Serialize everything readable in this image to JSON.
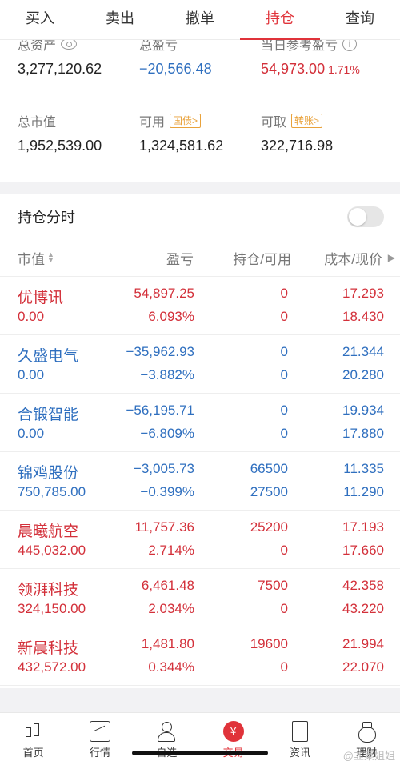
{
  "tabs": [
    {
      "label": "买入"
    },
    {
      "label": "卖出"
    },
    {
      "label": "撤单"
    },
    {
      "label": "持仓",
      "active": true
    },
    {
      "label": "查询"
    }
  ],
  "summary": {
    "total_assets_label": "总资产",
    "total_assets": "3,277,120.62",
    "total_pl_label": "总盈亏",
    "total_pl": "−20,566.48",
    "today_pl_label": "当日参考盈亏",
    "today_pl": "54,973.00",
    "today_pl_pct": "1.71%",
    "market_value_label": "总市值",
    "market_value": "1,952,539.00",
    "available_label": "可用",
    "available_tag": "国债>",
    "available": "1,324,581.62",
    "withdrawable_label": "可取",
    "withdrawable_tag": "转账>",
    "withdrawable": "322,716.98"
  },
  "holdings": {
    "title": "持仓分时",
    "toggle_on": false,
    "columns": {
      "market_value": "市值",
      "pl": "盈亏",
      "position": "持仓/可用",
      "cost_price": "成本/现价"
    },
    "rows": [
      {
        "name": "优博讯",
        "market_value": "0.00",
        "pl": "54,897.25",
        "pl_pct": "6.093%",
        "hold": "0",
        "avail": "0",
        "cost": "17.293",
        "price": "18.430",
        "trend": "up"
      },
      {
        "name": "久盛电气",
        "market_value": "0.00",
        "pl": "−35,962.93",
        "pl_pct": "−3.882%",
        "hold": "0",
        "avail": "0",
        "cost": "21.344",
        "price": "20.280",
        "trend": "down"
      },
      {
        "name": "合锻智能",
        "market_value": "0.00",
        "pl": "−56,195.71",
        "pl_pct": "−6.809%",
        "hold": "0",
        "avail": "0",
        "cost": "19.934",
        "price": "17.880",
        "trend": "down"
      },
      {
        "name": "锦鸡股份",
        "market_value": "750,785.00",
        "pl": "−3,005.73",
        "pl_pct": "−0.399%",
        "hold": "66500",
        "avail": "27500",
        "cost": "11.335",
        "price": "11.290",
        "trend": "down"
      },
      {
        "name": "晨曦航空",
        "market_value": "445,032.00",
        "pl": "11,757.36",
        "pl_pct": "2.714%",
        "hold": "25200",
        "avail": "0",
        "cost": "17.193",
        "price": "17.660",
        "trend": "up"
      },
      {
        "name": "领湃科技",
        "market_value": "324,150.00",
        "pl": "6,461.48",
        "pl_pct": "2.034%",
        "hold": "7500",
        "avail": "0",
        "cost": "42.358",
        "price": "43.220",
        "trend": "up"
      },
      {
        "name": "新晨科技",
        "market_value": "432,572.00",
        "pl": "1,481.80",
        "pl_pct": "0.344%",
        "hold": "19600",
        "avail": "0",
        "cost": "21.994",
        "price": "22.070",
        "trend": "up"
      }
    ]
  },
  "bottom_nav": [
    {
      "label": "首页",
      "icon": "candlestick-icon"
    },
    {
      "label": "行情",
      "icon": "chart-icon"
    },
    {
      "label": "自选",
      "icon": "user-icon"
    },
    {
      "label": "交易",
      "icon": "trade-icon",
      "glyph": "¥",
      "active": true
    },
    {
      "label": "资讯",
      "icon": "news-icon"
    },
    {
      "label": "理财",
      "icon": "moneybag-icon"
    }
  ],
  "watermark": "@韭菜姐姐",
  "colors": {
    "accent": "#e0333a",
    "up": "#d3303a",
    "down": "#2f6fbf",
    "tag": "#e9a23b"
  }
}
